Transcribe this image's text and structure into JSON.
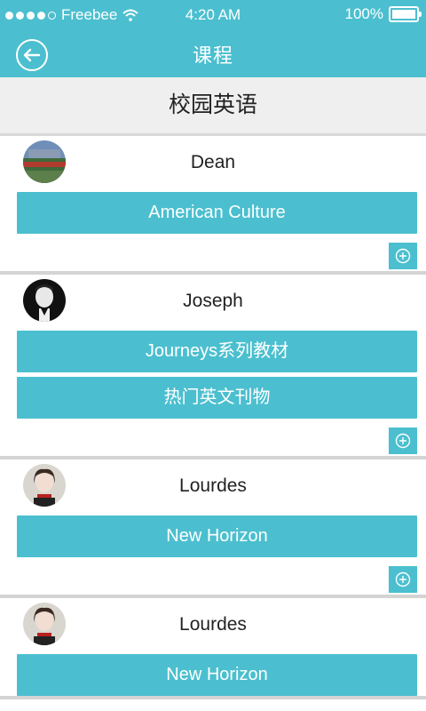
{
  "status_bar": {
    "carrier": "Freebee",
    "time": "4:20 AM",
    "battery": "100%",
    "battery_level": 1.0,
    "signal_bars": 4,
    "signal_total": 5
  },
  "header": {
    "title": "课程",
    "back_icon": "back-arrow-circle-icon"
  },
  "category": {
    "title": "校园英语"
  },
  "teachers": [
    {
      "name": "Dean",
      "avatar_icon": "avatar-photo-stadium",
      "courses": [
        "American Culture"
      ]
    },
    {
      "name": "Joseph",
      "avatar_icon": "avatar-photo-man",
      "courses": [
        "Journeys系列教材",
        "热门英文刊物"
      ]
    },
    {
      "name": "Lourdes",
      "avatar_icon": "avatar-photo-woman",
      "courses": [
        "New Horizon"
      ]
    },
    {
      "name": "Lourdes",
      "avatar_icon": "avatar-photo-woman",
      "courses": [
        "New Horizon"
      ]
    }
  ],
  "colors": {
    "accent": "#4bbfcf",
    "category_bg": "#efefef",
    "divider": "#d4d4d4"
  }
}
